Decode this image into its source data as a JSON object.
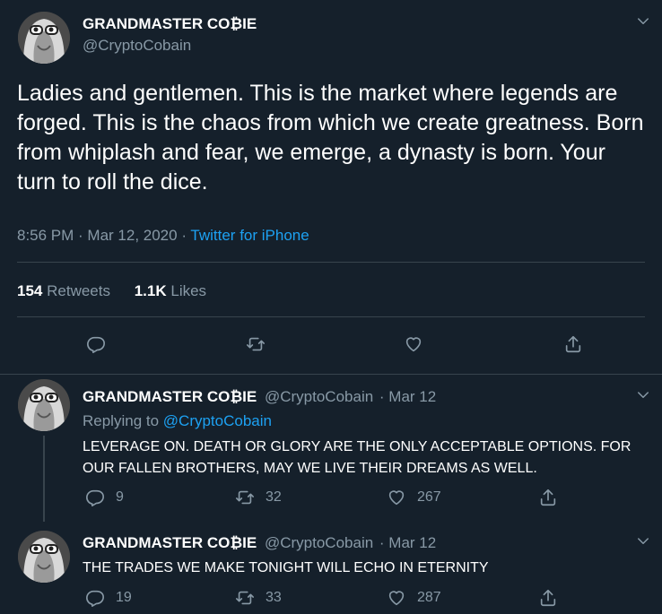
{
  "main_tweet": {
    "display_name": "GRANDMASTER CO₿IE",
    "handle": "@CryptoCobain",
    "text": "Ladies and gentlemen. This is the market where legends are forged. This is the chaos from which we create greatness. Born from whiplash and fear, we emerge, a dynasty is born. Your turn to roll the dice.",
    "time": "8:56 PM · Mar 12, 2020 · ",
    "source": "Twitter for iPhone",
    "retweets_count": "154",
    "retweets_label": "Retweets",
    "likes_count": "1.1K",
    "likes_label": "Likes"
  },
  "replies": [
    {
      "display_name": "GRANDMASTER CO₿IE",
      "handle": "@CryptoCobain",
      "date": "· Mar 12",
      "replying_to_label": "Replying to ",
      "replying_to_handle": "@CryptoCobain",
      "text": "LEVERAGE ON. DEATH OR GLORY ARE THE ONLY ACCEPTABLE OPTIONS. FOR OUR FALLEN BROTHERS, MAY WE LIVE THEIR DREAMS AS WELL.",
      "reply_count": "9",
      "retweet_count": "32",
      "like_count": "267"
    },
    {
      "display_name": "GRANDMASTER CO₿IE",
      "handle": "@CryptoCobain",
      "date": "· Mar 12",
      "text": "THE TRADES WE MAKE TONIGHT WILL ECHO IN ETERNITY",
      "reply_count": "19",
      "retweet_count": "33",
      "like_count": "287"
    }
  ],
  "icons": {
    "reply": "reply-icon",
    "retweet": "retweet-icon",
    "like": "heart-icon",
    "share": "share-icon",
    "caret": "chevron-down-icon"
  },
  "colors": {
    "background": "#15202b",
    "text": "#ffffff",
    "muted": "#8899a6",
    "accent": "#1da1f2",
    "border": "#38444d"
  }
}
